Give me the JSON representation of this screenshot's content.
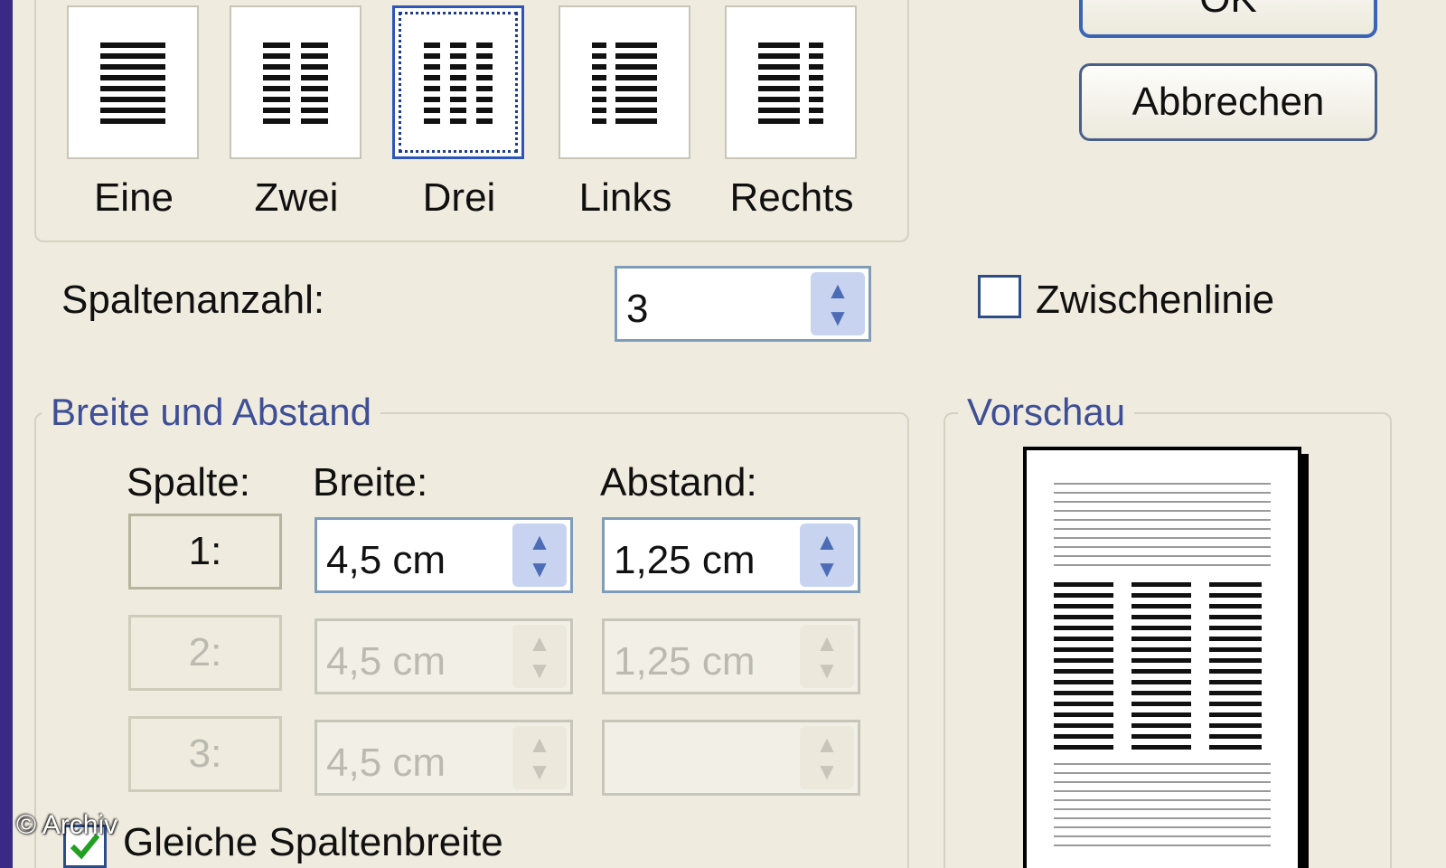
{
  "presets": [
    {
      "name": "Eine",
      "accesskey": "E"
    },
    {
      "name": "Zwei",
      "accesskey": "Z"
    },
    {
      "name": "Drei",
      "accesskey": "D"
    },
    {
      "name": "Links",
      "accesskey": "L"
    },
    {
      "name": "Rechts",
      "accesskey": "R"
    }
  ],
  "selected_preset": "Drei",
  "buttons": {
    "ok_label": "OK",
    "cancel_label": "Abbrechen"
  },
  "column_count": {
    "label": "Spaltenanzahl:",
    "value": "3"
  },
  "separator_line": {
    "label": "Zwischenlinie",
    "checked": false
  },
  "width_spacing": {
    "legend": "Breite und Abstand",
    "headers": {
      "column": "Spalte:",
      "width": "Breite:",
      "spacing": "Abstand:"
    },
    "rows": [
      {
        "col": "1:",
        "width": "4,5 cm",
        "spacing": "1,25 cm",
        "enabled": true
      },
      {
        "col": "2:",
        "width": "4,5 cm",
        "spacing": "1,25 cm",
        "enabled": false
      },
      {
        "col": "3:",
        "width": "4,5 cm",
        "spacing": "",
        "enabled": false
      }
    ]
  },
  "equal_width": {
    "label": "Gleiche Spaltenbreite",
    "checked": true
  },
  "preview": {
    "legend": "Vorschau"
  },
  "watermark": "© Archiv",
  "colors": {
    "dialog_bg": "#efebde",
    "accent_blue": "#3e4f97",
    "checkbox_check": "#21a121"
  }
}
